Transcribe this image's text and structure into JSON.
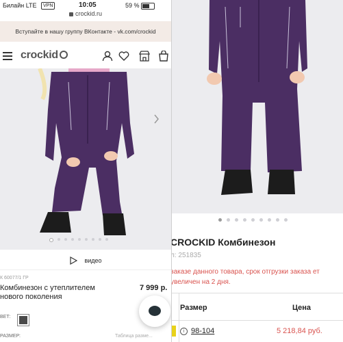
{
  "left": {
    "status": {
      "carrier": "Билайн  LTE",
      "vpn": "VPN",
      "time": "10:05",
      "battery": "59 %"
    },
    "url": "crockid.ru",
    "banner": "Вступайте в нашу группу ВКонтакте - vk.com/crockid",
    "logo": "crockid",
    "video_label": "видео",
    "sku": "К 60077/1 ГР",
    "title": "Комбинезон с утеплителем нового поколения",
    "price": "7 999 р.",
    "color_label": "ВЕТ:",
    "size_label": "РАЗМЕР:",
    "size_table": "Таблица разме..."
  },
  "right": {
    "title": "CROCKID Комбинезон",
    "code": "л: 251835",
    "warning": "заказе данного товара, срок отгрузки заказа ет увеличен на 2 дня.",
    "table": {
      "header_size": "Размер",
      "header_price": "Цена",
      "size": "98-104",
      "price": "5 218,84 руб."
    }
  },
  "colors": {
    "accent_red": "#d9534f",
    "garment": "#4b2e63",
    "banner_bg": "#f3ebe6"
  }
}
